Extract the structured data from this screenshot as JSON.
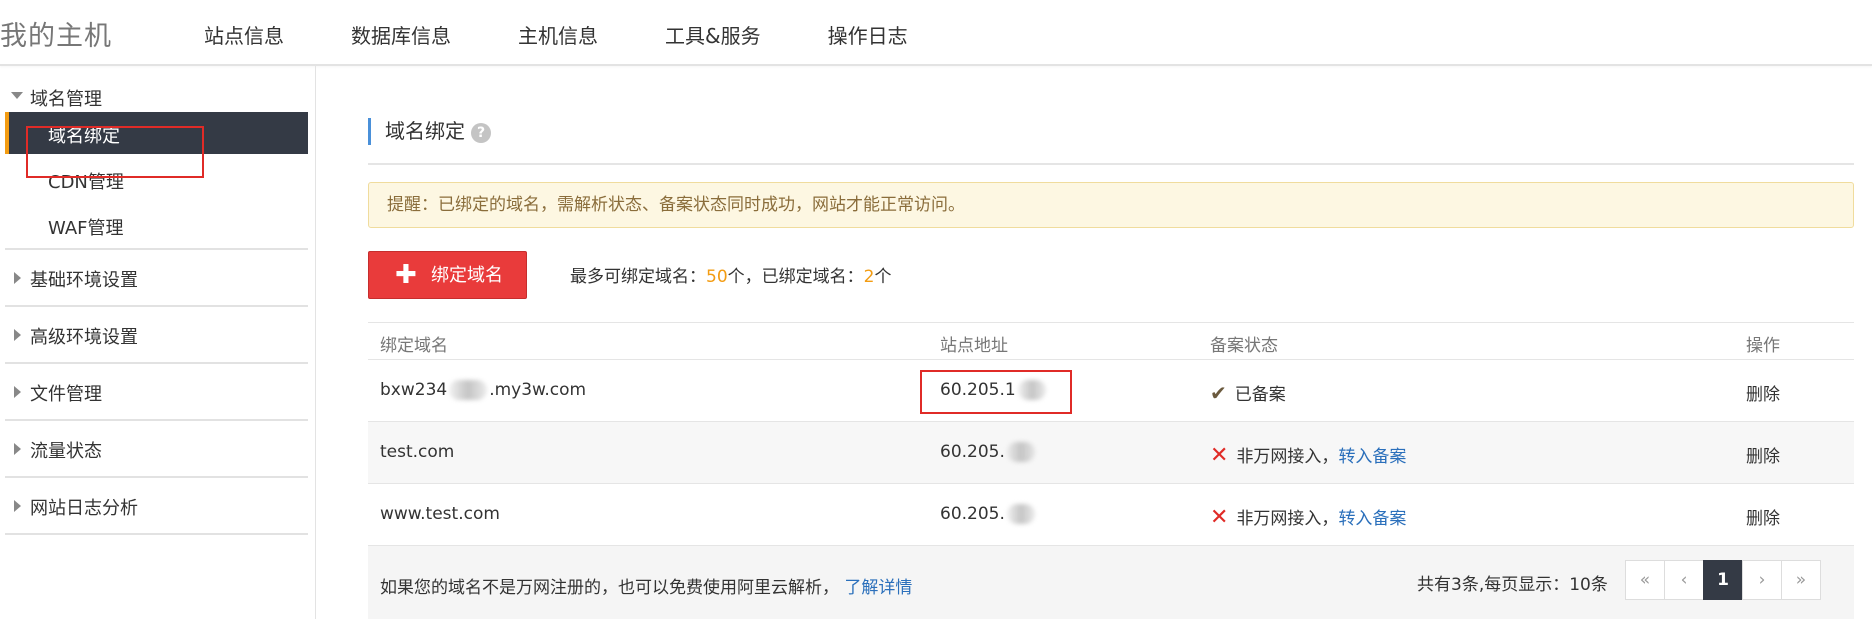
{
  "header": {
    "brand": "我的主机",
    "nav": [
      "站点信息",
      "数据库信息",
      "主机信息",
      "工具&服务",
      "操作日志"
    ]
  },
  "sidebar": {
    "domain_group": "域名管理",
    "sub_items": [
      "域名绑定",
      "CDN管理",
      "WAF管理"
    ],
    "groups": [
      "基础环境设置",
      "高级环境设置",
      "文件管理",
      "流量状态",
      "网站日志分析"
    ]
  },
  "main": {
    "title": "域名绑定",
    "help_icon": "?",
    "notice": "提醒：已绑定的域名，需解析状态、备案状态同时成功，网站才能正常访问。",
    "bind_button": "绑定域名",
    "summary": {
      "max_label": "最多可绑定域名：",
      "max_value": "50",
      "max_unit": "个，已绑定域名：",
      "bound_value": "2",
      "bound_unit": "个"
    },
    "table": {
      "headers": [
        "绑定域名",
        "站点地址",
        "备案状态",
        "操作"
      ],
      "rows": [
        {
          "domain_a": "bxw234",
          "domain_b": ".my3w.com",
          "ip": "60.205.1",
          "status": "已备案",
          "action": "删除"
        },
        {
          "domain": "test.com",
          "ip": "60.205.",
          "status": "非万网接入，",
          "status_link": "转入备案",
          "action": "删除"
        },
        {
          "domain": "www.test.com",
          "ip": "60.205.",
          "status": "非万网接入，",
          "status_link": "转入备案",
          "action": "删除"
        }
      ]
    },
    "footer": {
      "tip": "如果您的域名不是万网注册的，也可以免费使用阿里云解析，",
      "tip_link": "了解详情",
      "count": "共有3条,每页显示：10条",
      "pager": [
        "«",
        "‹",
        "1",
        "›",
        "»"
      ]
    }
  },
  "colors": {
    "accent_red": "#e93b3b",
    "sidebar_active": "#343a45",
    "active_marker": "#f39c12",
    "link_blue": "#2a6fbb"
  }
}
